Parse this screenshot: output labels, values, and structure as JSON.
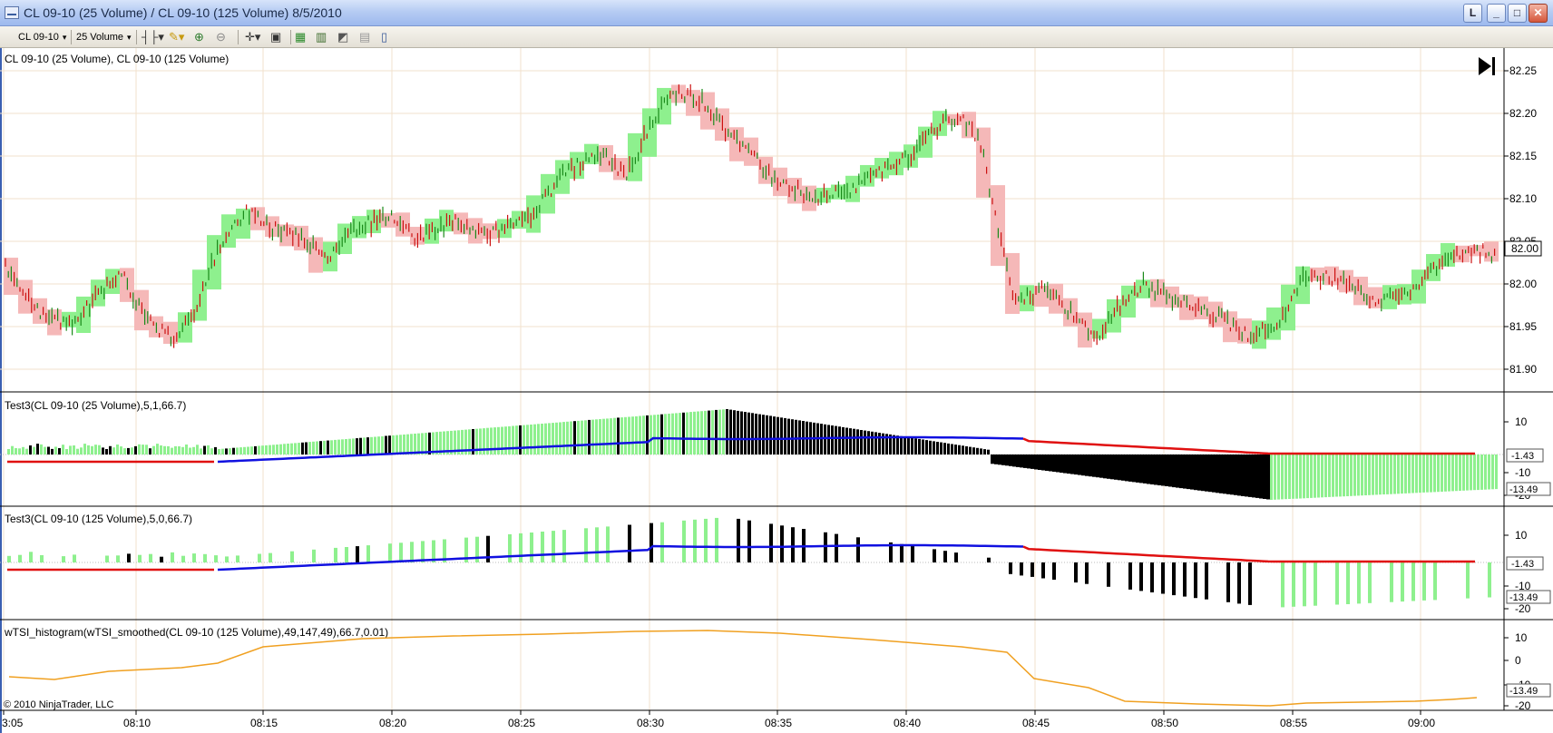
{
  "window": {
    "title": "CL 09-10 (25 Volume) / CL 09-10 (125 Volume)  8/5/2010",
    "buttons": [
      "L",
      "_",
      "□",
      "✕"
    ]
  },
  "toolbar": {
    "instrument": "CL 09-10",
    "period": "25 Volume",
    "icons": [
      "bar-type-icon",
      "drawing-tool-icon",
      "zoom-in-icon",
      "zoom-out-icon",
      "crosshair-icon",
      "data-box-icon",
      "properties-icon",
      "indicators-icon",
      "strategies-icon",
      "chart-trader-icon",
      "window-linking-icon"
    ]
  },
  "panels": {
    "price": {
      "label": "CL 09-10 (25 Volume), CL 09-10 (125 Volume)",
      "ticks": [
        "82.25",
        "82.20",
        "82.15",
        "82.10",
        "82.05",
        "82.00",
        "81.95",
        "81.90"
      ],
      "last_price": "82.00"
    },
    "test3_25": {
      "label": "Test3(CL 09-10 (25 Volume),5,1,66.7)",
      "ticks": [
        "10",
        "-10",
        "-20"
      ],
      "badges": [
        "-1.43",
        "-13.49"
      ]
    },
    "test3_125": {
      "label": "Test3(CL 09-10 (125 Volume),5,0,66.7)",
      "ticks": [
        "10",
        "-10",
        "-20"
      ],
      "badges": [
        "-1.43",
        "-13.49"
      ]
    },
    "wtsi": {
      "label": "wTSI_histogram(wTSI_smoothed(CL 09-10 (125 Volume),49,147,49),66.7,0.01)",
      "ticks": [
        "10",
        "0",
        "-10",
        "-20"
      ],
      "badges": [
        "-13.49"
      ]
    }
  },
  "time_axis": [
    "3:05",
    "08:10",
    "08:15",
    "08:20",
    "08:25",
    "08:30",
    "08:35",
    "08:40",
    "08:45",
    "08:50",
    "08:55",
    "09:00"
  ],
  "copyright": "© 2010 NinjaTrader, LLC",
  "colors": {
    "up": "#8ef08e",
    "down": "#f5b8b8",
    "bar_up": "#1a8a1a",
    "bar_down": "#cc1111",
    "black": "#000000",
    "line_red": "#e01010",
    "line_blue": "#1010e0",
    "line_orange": "#f0a020",
    "bg": "#ffffff",
    "grid": "#f2e2cc"
  }
}
